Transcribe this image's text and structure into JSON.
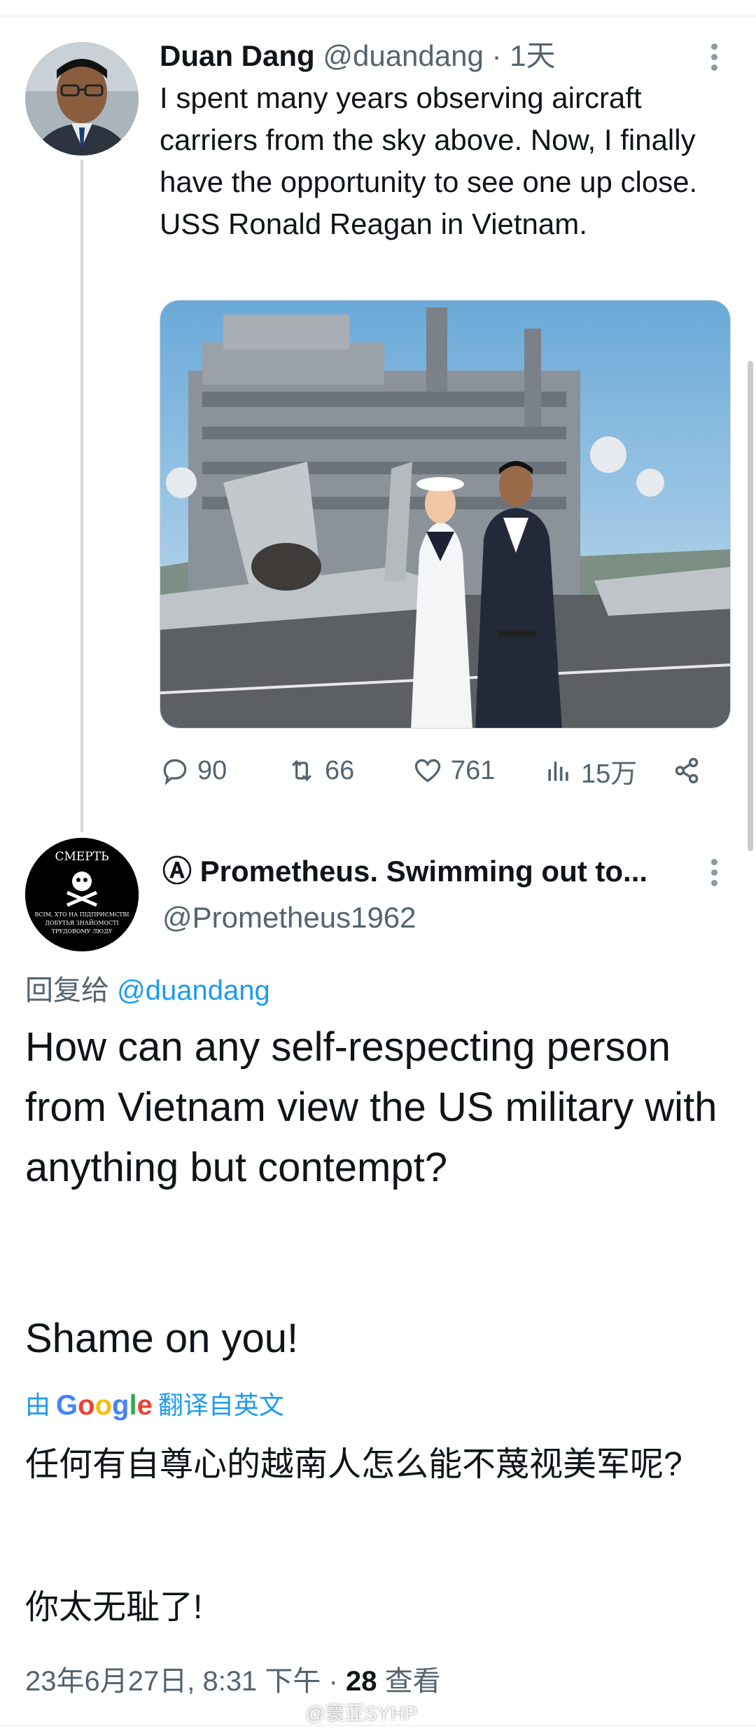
{
  "tweet": {
    "author_name": "Duan Dang",
    "author_handle": "@duandang",
    "separator": "·",
    "time": "1天",
    "text": "I spent many years observing aircraft carriers from the sky above. Now, I finally have the opportunity to see one up close. USS Ronald Reagan in Vietnam.",
    "stats": {
      "replies": "90",
      "retweets": "66",
      "likes": "761",
      "views": "15万"
    }
  },
  "reply": {
    "author_name": "Ⓐ Prometheus. Swimming out to...",
    "author_handle": "@Prometheus1962",
    "avatar_text": [
      "СМЕРТЬ",
      "ВСІМ, ХТО НА ПІДПРИЄМСТВІ",
      "ДОБУТЬЯ ЗНАЙОМОСТІ",
      "ТРУДОВОМУ ЛЮДУ"
    ],
    "replying_to_prefix": "回复给",
    "replying_to_handle": "@duandang",
    "text_para1": "How can any self-respecting person from Vietnam view the US military with anything but contempt?",
    "text_para2": "Shame on you!",
    "translation_prefix": "由",
    "translation_provider": "Google",
    "translation_suffix": "翻译自英文",
    "translated_para1": "任何有自尊心的越南人怎么能不蔑视美军呢?",
    "translated_para2": "你太无耻了!",
    "timestamp": "23年6月27日, 8:31 下午",
    "dot": "·",
    "views_count": "28",
    "views_label": "查看"
  },
  "watermark": "@寰亚SYHP",
  "colors": {
    "accent": "#1d9bf0",
    "secondary_text": "#536471",
    "primary_text": "#0f1419"
  },
  "icons": [
    "more-icon",
    "reply-icon",
    "retweet-icon",
    "like-icon",
    "views-icon",
    "share-icon"
  ]
}
